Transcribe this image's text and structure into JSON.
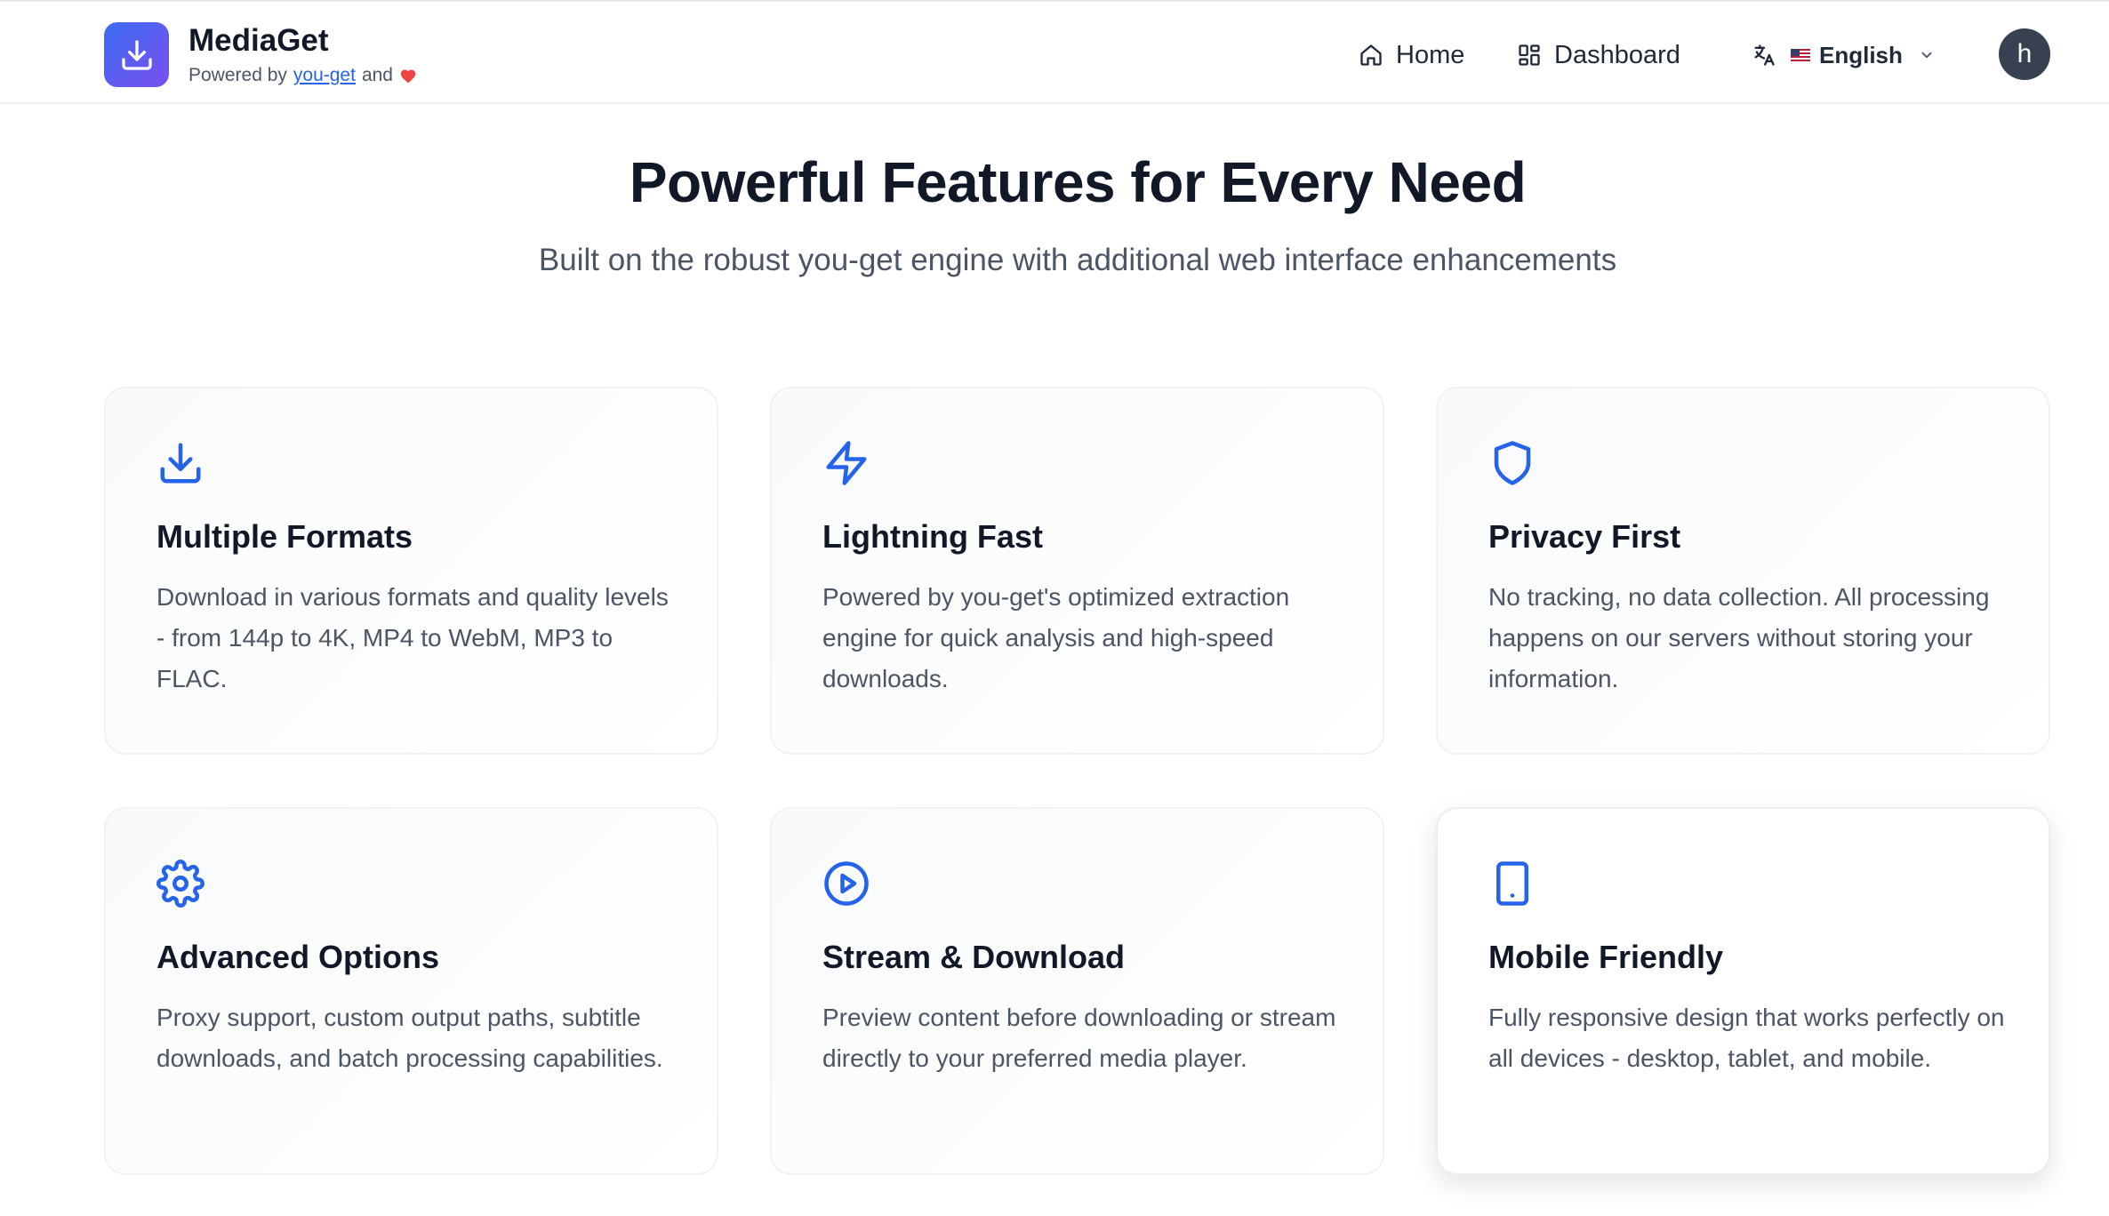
{
  "header": {
    "brand_name": "MediaGet",
    "powered_by": "Powered by",
    "engine_link": "you-get",
    "and_text": "and",
    "nav": {
      "home": "Home",
      "dashboard": "Dashboard"
    },
    "language": "English",
    "avatar_initial": "h"
  },
  "hero": {
    "title": "Powerful Features for Every Need",
    "subtitle": "Built on the robust you-get engine with additional web interface enhancements"
  },
  "features": [
    {
      "icon": "download-icon",
      "title": "Multiple Formats",
      "description": "Download in various formats and quality levels - from 144p to 4K, MP4 to WebM, MP3 to FLAC."
    },
    {
      "icon": "lightning-icon",
      "title": "Lightning Fast",
      "description": "Powered by you-get's optimized extraction engine for quick analysis and high-speed downloads."
    },
    {
      "icon": "shield-icon",
      "title": "Privacy First",
      "description": "No tracking, no data collection. All processing happens on our servers without storing your information."
    },
    {
      "icon": "gear-icon",
      "title": "Advanced Options",
      "description": "Proxy support, custom output paths, subtitle downloads, and batch processing capabilities."
    },
    {
      "icon": "play-circle-icon",
      "title": "Stream & Download",
      "description": "Preview content before downloading or stream directly to your preferred media player."
    },
    {
      "icon": "mobile-icon",
      "title": "Mobile Friendly",
      "description": "Fully responsive design that works perfectly on all devices - desktop, tablet, and mobile."
    }
  ],
  "colors": {
    "accent": "#2563eb",
    "logo_gradient_start": "#3b6ef0",
    "logo_gradient_end": "#7b4ef0",
    "heart": "#ef4444",
    "avatar_bg": "#374151"
  }
}
